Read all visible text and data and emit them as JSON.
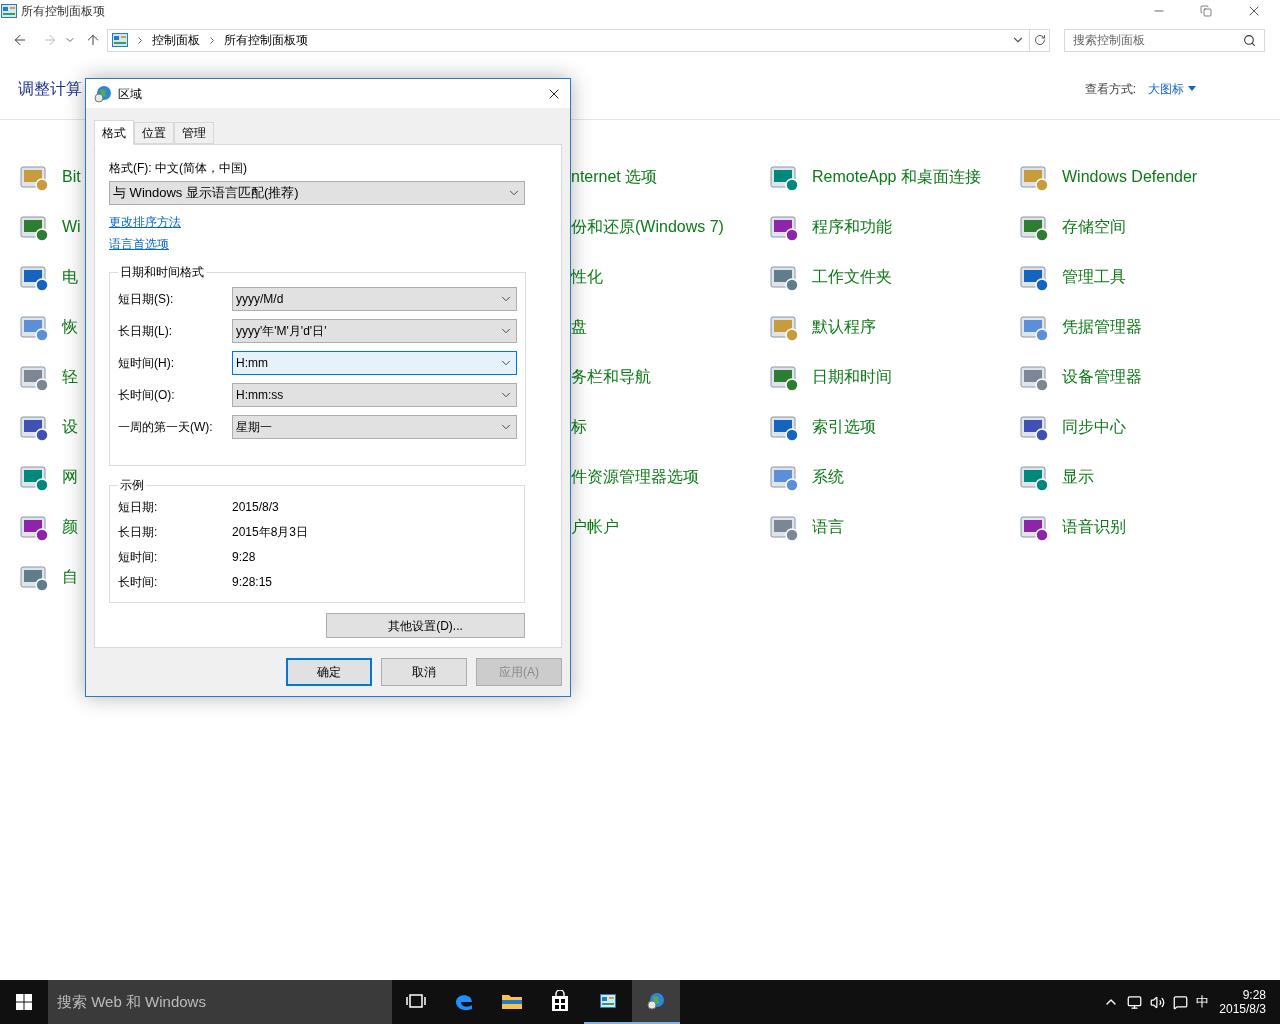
{
  "window": {
    "title": "所有控制面板项"
  },
  "breadcrumb": [
    "控制面板",
    "所有控制面板项"
  ],
  "search": {
    "placeholder": "搜索控制面板"
  },
  "heading": "调整计算",
  "view_by": {
    "label": "查看方式:",
    "value": "大图标"
  },
  "columns": [
    {
      "kind": "icons",
      "items": [
        {
          "label": "Bit"
        },
        {
          "label": "Wi"
        },
        {
          "label": "电"
        },
        {
          "label": "恢"
        },
        {
          "label": "轻"
        },
        {
          "label": "设"
        },
        {
          "label": "网"
        },
        {
          "label": "颜"
        },
        {
          "label": "自"
        }
      ]
    },
    {
      "kind": "text",
      "items": [
        {
          "label": "nternet 选项"
        },
        {
          "label": "份和还原(Windows 7)"
        },
        {
          "label": "性化"
        },
        {
          "label": "盘"
        },
        {
          "label": "务栏和导航"
        },
        {
          "label": "标"
        },
        {
          "label": "件资源管理器选项"
        },
        {
          "label": "户帐户"
        }
      ]
    },
    {
      "kind": "icons",
      "items": [
        {
          "label": "RemoteApp 和桌面连接"
        },
        {
          "label": "程序和功能"
        },
        {
          "label": "工作文件夹"
        },
        {
          "label": "默认程序"
        },
        {
          "label": "日期和时间"
        },
        {
          "label": "索引选项"
        },
        {
          "label": "系统"
        },
        {
          "label": "语言"
        }
      ]
    },
    {
      "kind": "icons",
      "items": [
        {
          "label": "Windows Defender"
        },
        {
          "label": "存储空间"
        },
        {
          "label": "管理工具"
        },
        {
          "label": "凭据管理器"
        },
        {
          "label": "设备管理器"
        },
        {
          "label": "同步中心"
        },
        {
          "label": "显示"
        },
        {
          "label": "语音识别"
        }
      ]
    }
  ],
  "dialog": {
    "title": "区域",
    "tabs": [
      {
        "label": "格式",
        "selected": true
      },
      {
        "label": "位置",
        "selected": false
      },
      {
        "label": "管理",
        "selected": false
      }
    ],
    "format_label": "格式(F): 中文(简体，中国)",
    "format_select": "与 Windows 显示语言匹配(推荐)",
    "links": [
      "更改排序方法",
      "语言首选项"
    ],
    "formats_group": "日期和时间格式",
    "fields": [
      {
        "label": "短日期(S):",
        "value": "yyyy/M/d",
        "focused": false
      },
      {
        "label": "长日期(L):",
        "value": "yyyy'年'M'月'd'日'",
        "focused": false
      },
      {
        "label": "短时间(H):",
        "value": "H:mm",
        "focused": true
      },
      {
        "label": "长时间(O):",
        "value": "H:mm:ss",
        "focused": false
      },
      {
        "label": "一周的第一天(W):",
        "value": "星期一",
        "focused": false
      }
    ],
    "example_group": "示例",
    "examples": [
      {
        "label": "短日期:",
        "value": "2015/8/3"
      },
      {
        "label": "长日期:",
        "value": "2015年8月3日"
      },
      {
        "label": "短时间:",
        "value": "9:28"
      },
      {
        "label": "长时间:",
        "value": "9:28:15"
      }
    ],
    "more_button": "其他设置(D)...",
    "buttons": [
      {
        "label": "确定",
        "default": true,
        "disabled": false
      },
      {
        "label": "取消",
        "default": false,
        "disabled": false
      },
      {
        "label": "应用(A)",
        "default": false,
        "disabled": true
      }
    ]
  },
  "taskbar": {
    "search_placeholder": "搜索 Web 和 Windows",
    "apps": [
      {
        "kind": "taskview",
        "open": false,
        "selected": false
      },
      {
        "kind": "edge",
        "open": false,
        "selected": false
      },
      {
        "kind": "explorer",
        "open": false,
        "selected": false
      },
      {
        "kind": "store",
        "open": false,
        "selected": false
      },
      {
        "kind": "controlpanel",
        "open": true,
        "selected": false
      },
      {
        "kind": "region",
        "open": true,
        "selected": true
      }
    ],
    "ime": "中",
    "time": "9:28",
    "date": "2015/8/3"
  }
}
